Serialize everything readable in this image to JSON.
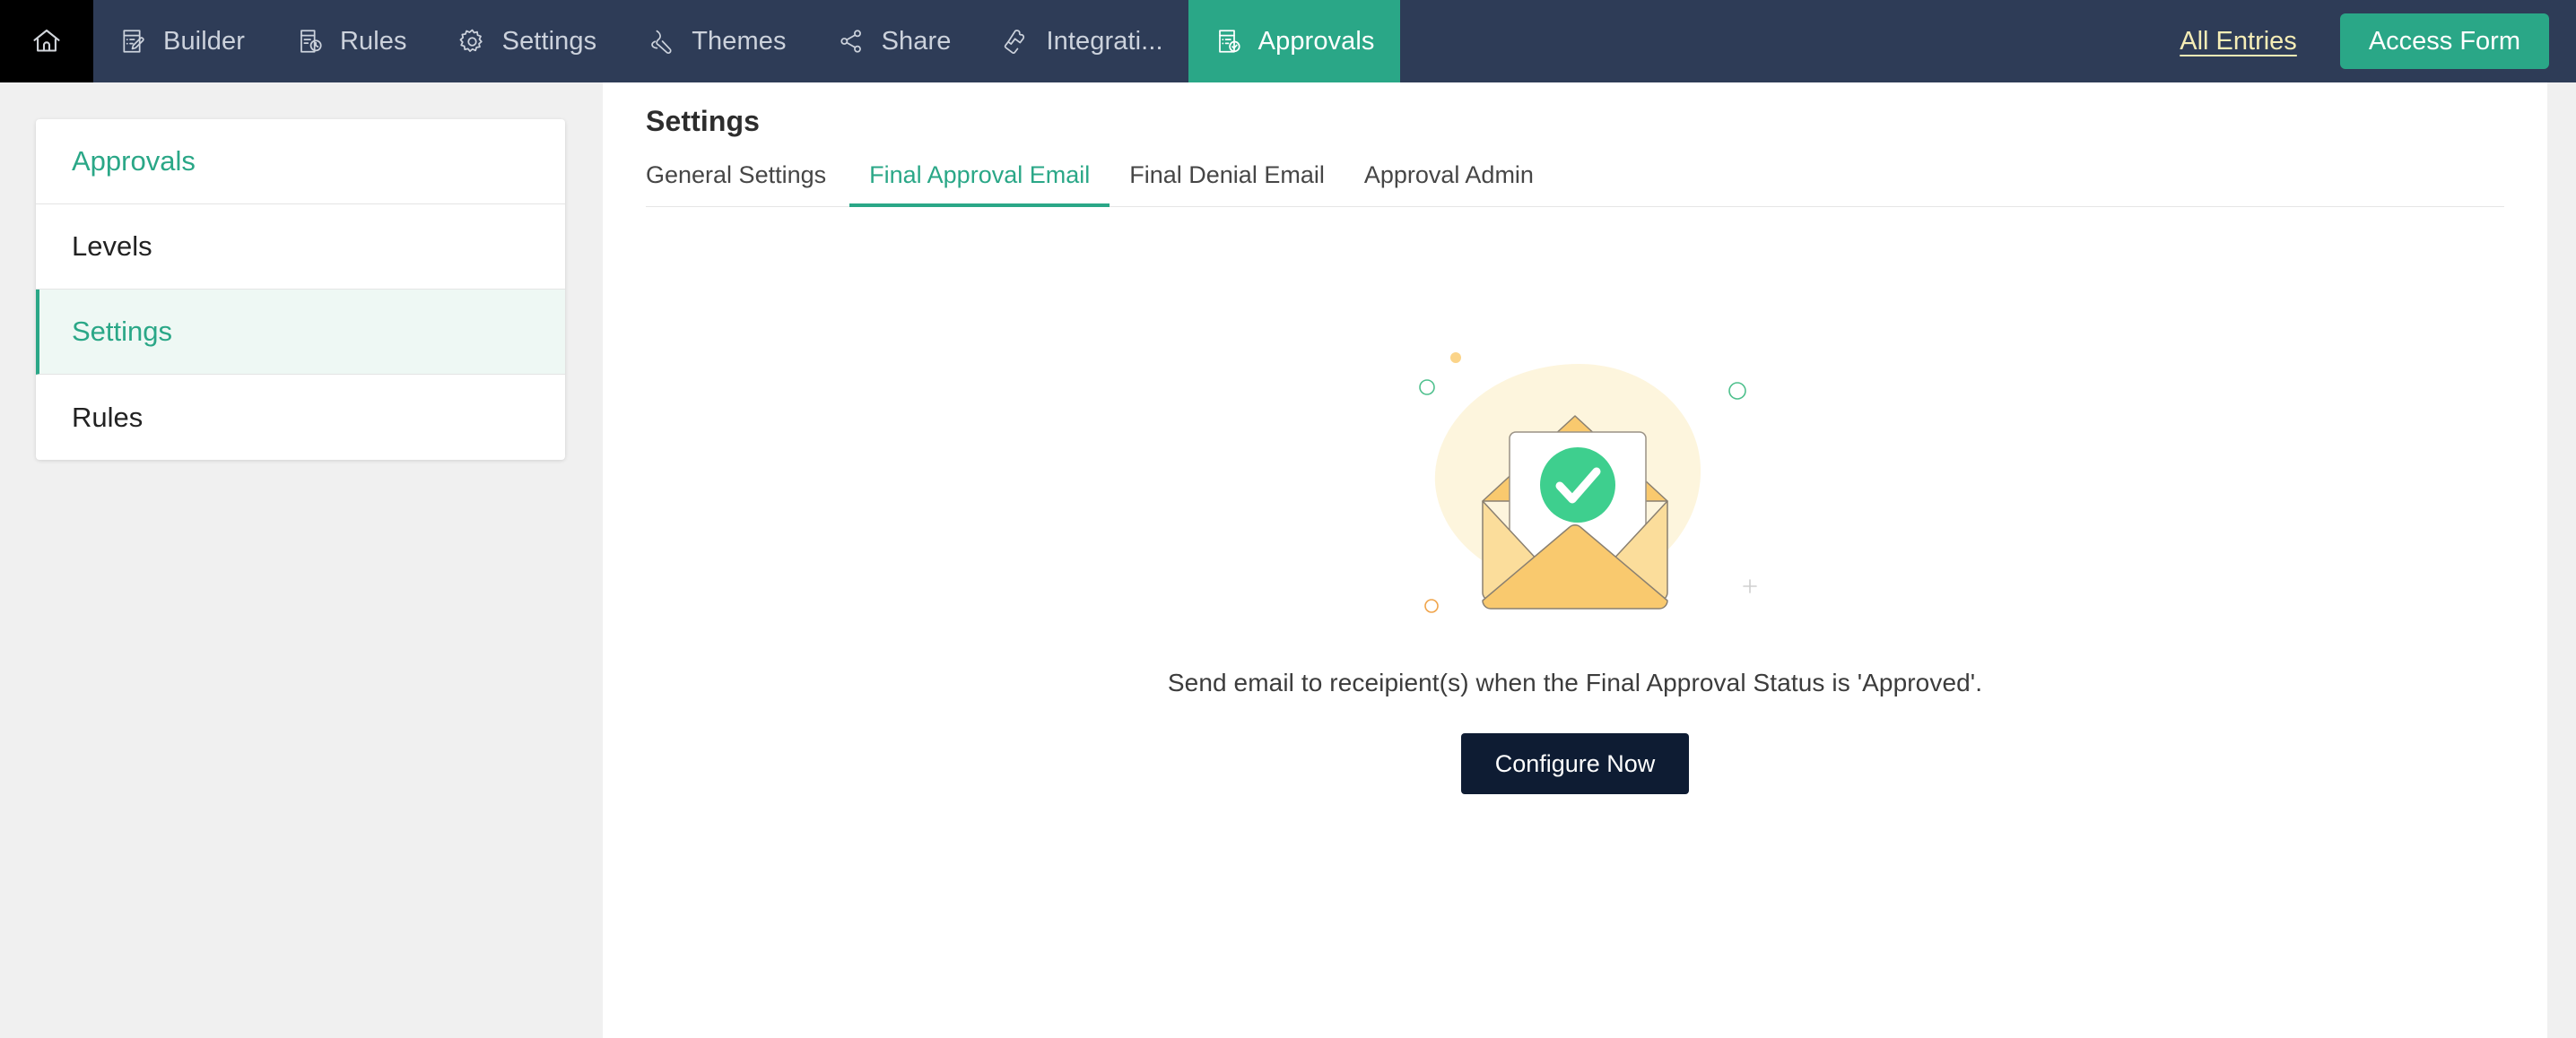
{
  "navbar": {
    "home_icon": "home-icon",
    "items": [
      {
        "label": "Builder",
        "icon": "document-pencil-icon",
        "active": false
      },
      {
        "label": "Rules",
        "icon": "document-clock-icon",
        "active": false
      },
      {
        "label": "Settings",
        "icon": "gear-icon",
        "active": false
      },
      {
        "label": "Themes",
        "icon": "brush-icon",
        "active": false
      },
      {
        "label": "Share",
        "icon": "share-nodes-icon",
        "active": false
      },
      {
        "label": "Integrati...",
        "icon": "puzzle-piece-icon",
        "active": false
      },
      {
        "label": "Approvals",
        "icon": "document-check-icon",
        "active": true
      }
    ],
    "all_entries_label": "All Entries",
    "access_form_label": "Access Form",
    "colors": {
      "background": "#2e3c57",
      "active_tab": "#2aa787",
      "link": "#f5edb6",
      "home_cell": "#000000"
    }
  },
  "sidebar": {
    "title": "Approvals",
    "items": [
      {
        "label": "Levels",
        "active": false
      },
      {
        "label": "Settings",
        "active": true
      },
      {
        "label": "Rules",
        "active": false
      }
    ],
    "colors": {
      "accent": "#2aa787",
      "active_background": "#eef8f4"
    }
  },
  "main": {
    "page_title": "Settings",
    "tabs": [
      {
        "label": "General Settings",
        "active": false
      },
      {
        "label": "Final Approval Email",
        "active": true
      },
      {
        "label": "Final Denial Email",
        "active": false
      },
      {
        "label": "Approval Admin",
        "active": false
      }
    ],
    "empty_state": {
      "illustration": "envelope-with-green-checkmark-illustration",
      "message": "Send email to receipient(s) when the Final Approval Status is 'Approved'.",
      "button_label": "Configure Now",
      "colors": {
        "blob": "#fdf5dd",
        "envelope_light": "#fbdd9b",
        "envelope_mid": "#fbd489",
        "envelope_flap": "#f9c96e",
        "check_circle": "#3ecf8e",
        "button": "#0e1c33"
      }
    }
  }
}
